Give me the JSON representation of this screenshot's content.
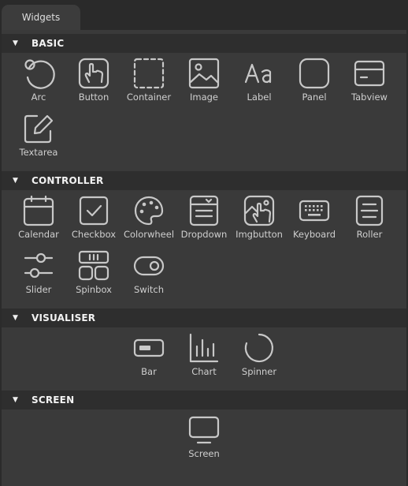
{
  "tab": {
    "label": "Widgets"
  },
  "sections": {
    "basic": {
      "title": "BASIC",
      "items": [
        "Arc",
        "Button",
        "Container",
        "Image",
        "Label",
        "Panel",
        "Tabview",
        "Textarea"
      ],
      "icons": [
        "arc-icon",
        "button-icon",
        "container-icon",
        "image-icon",
        "label-icon",
        "panel-icon",
        "tabview-icon",
        "textarea-icon"
      ]
    },
    "controller": {
      "title": "CONTROLLER",
      "items": [
        "Calendar",
        "Checkbox",
        "Colorwheel",
        "Dropdown",
        "Imgbutton",
        "Keyboard",
        "Roller",
        "Slider",
        "Spinbox",
        "Switch"
      ],
      "icons": [
        "calendar-icon",
        "checkbox-icon",
        "colorwheel-icon",
        "dropdown-icon",
        "imgbutton-icon",
        "keyboard-icon",
        "roller-icon",
        "slider-icon",
        "spinbox-icon",
        "switch-icon"
      ]
    },
    "visualiser": {
      "title": "VISUALISER",
      "items": [
        "Bar",
        "Chart",
        "Spinner"
      ],
      "icons": [
        "bar-icon",
        "chart-icon",
        "spinner-icon"
      ]
    },
    "screen": {
      "title": "SCREEN",
      "items": [
        "Screen"
      ],
      "icons": [
        "screen-icon"
      ]
    }
  },
  "colors": {
    "background": "#3a3a3a",
    "header": "#2e2e2e",
    "icon": "#c8c8c8",
    "text": "#cfcfcf"
  }
}
